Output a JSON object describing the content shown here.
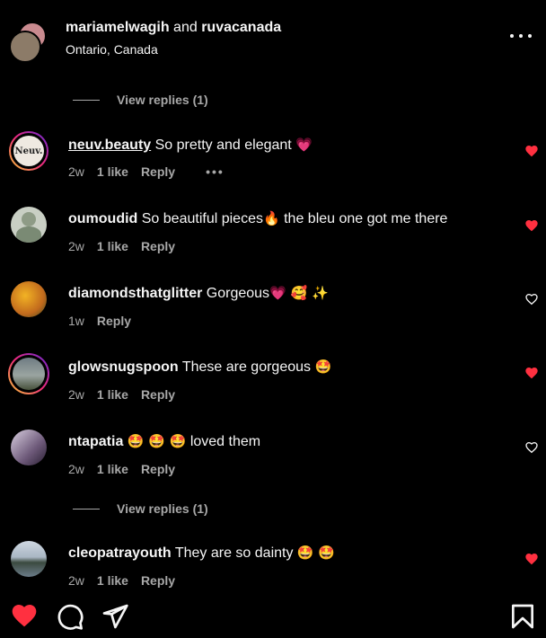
{
  "header": {
    "user_a": "mariamelwagih",
    "joiner": " and ",
    "user_b": "ruvacanada",
    "location": "Ontario, Canada"
  },
  "view_replies_1": "View replies (1)",
  "view_replies_2": "View replies (1)",
  "comments": [
    {
      "user": "neuv.beauty",
      "text": " So pretty and elegant ",
      "emoji": "💗",
      "time": "2w",
      "likes": "1 like",
      "reply": "Reply",
      "liked": true,
      "avatar_text": "Neuv."
    },
    {
      "user": "oumoudid",
      "text": " So beautiful pieces",
      "emoji": "🔥",
      "text2": " the bleu one got me there",
      "time": "2w",
      "likes": "1 like",
      "reply": "Reply",
      "liked": true
    },
    {
      "user": "diamondsthatglitter",
      "text": " Gorgeous",
      "emoji": "💗 🥰 ✨",
      "time": "1w",
      "reply": "Reply",
      "liked": false
    },
    {
      "user": "glowsnugspoon",
      "text": " These are gorgeous ",
      "emoji": "🤩",
      "time": "2w",
      "likes": "1 like",
      "reply": "Reply",
      "liked": true
    },
    {
      "user": "ntapatia",
      "text": " ",
      "emoji": "🤩 🤩 🤩",
      "text2": " loved them",
      "time": "2w",
      "likes": "1 like",
      "reply": "Reply",
      "liked": false
    },
    {
      "user": "cleopatrayouth",
      "text": " They are so dainty ",
      "emoji": "🤩 🤩",
      "time": "2w",
      "likes": "1 like",
      "reply": "Reply",
      "liked": true
    }
  ],
  "colors": {
    "heart_red": "#ff3040",
    "secondary_text": "#a8a8a8"
  }
}
